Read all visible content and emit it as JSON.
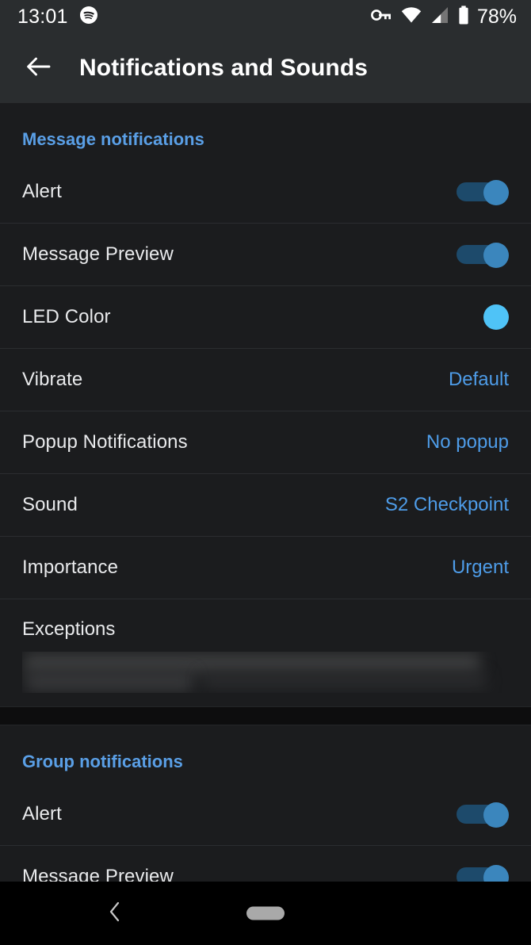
{
  "status_bar": {
    "clock": "13:01",
    "battery_percent": "78%",
    "icons": {
      "app": "spotify-icon",
      "vpn": "vpn-key-icon",
      "wifi": "wifi-icon",
      "cellular": "cellular-signal-icon",
      "battery": "battery-icon"
    }
  },
  "app_bar": {
    "back_icon": "arrow-back-icon",
    "title": "Notifications and Sounds"
  },
  "colors": {
    "accent_blue": "#4e9ce8",
    "section_header_blue": "#5a9fe6",
    "led_color": "#4fc3f7",
    "toggle_track": "#1d4a6b",
    "toggle_thumb": "#3b86bd",
    "background": "#1b1c1e",
    "app_bar_background": "#2a2d2f"
  },
  "sections": [
    {
      "header": "Message notifications",
      "rows": [
        {
          "label": "Alert",
          "control": "toggle",
          "value": "on"
        },
        {
          "label": "Message Preview",
          "control": "toggle",
          "value": "on"
        },
        {
          "label": "LED Color",
          "control": "color-dot",
          "value": "#4fc3f7"
        },
        {
          "label": "Vibrate",
          "control": "value",
          "value": "Default"
        },
        {
          "label": "Popup Notifications",
          "control": "value",
          "value": "No popup"
        },
        {
          "label": "Sound",
          "control": "value",
          "value": "S2 Checkpoint"
        },
        {
          "label": "Importance",
          "control": "value",
          "value": "Urgent"
        },
        {
          "label": "Exceptions",
          "control": "blurred",
          "value": ""
        }
      ]
    },
    {
      "header": "Group notifications",
      "rows": [
        {
          "label": "Alert",
          "control": "toggle",
          "value": "on"
        },
        {
          "label": "Message Preview",
          "control": "toggle",
          "value": "on"
        }
      ]
    }
  ],
  "nav_bar": {
    "back_icon": "nav-back-chevron-icon",
    "home_handle": "gesture-home-pill"
  }
}
